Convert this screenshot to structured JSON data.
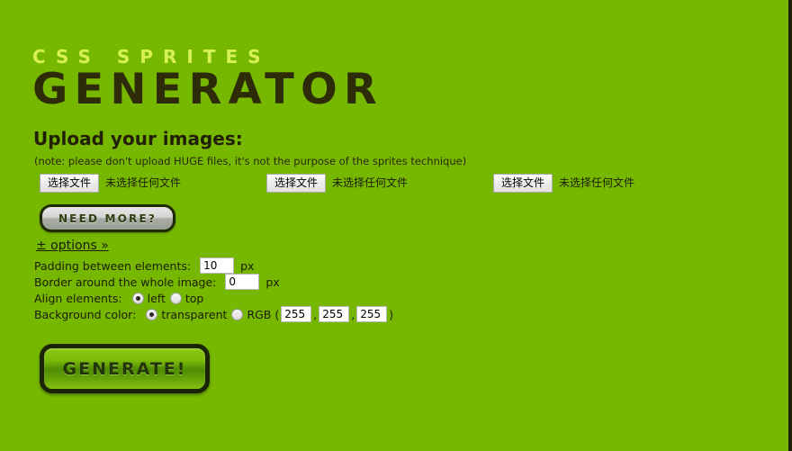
{
  "theme": {
    "background_color": "#76b800",
    "logo_small_color": "#d6f055",
    "logo_big_color": "#2e2b09",
    "text_color": "#1d1b06",
    "generate_button_color": "#7cbb0a",
    "need_more_button_color": "#d3d3d3",
    "edge_color": "#1d2206"
  },
  "logo": {
    "line1": "CSS SPRITES",
    "line2": "GENERATOR"
  },
  "upload": {
    "heading": "Upload your images:",
    "note": "(note: please don't upload HUGE files, it's not the purpose of the sprites technique)",
    "file_inputs": [
      {
        "button_label": "选择文件",
        "file_status": "未选择任何文件"
      },
      {
        "button_label": "选择文件",
        "file_status": "未选择任何文件"
      },
      {
        "button_label": "选择文件",
        "file_status": "未选择任何文件"
      }
    ],
    "need_more_label": "NEED MORE?"
  },
  "options": {
    "toggle_label": "± options »",
    "padding": {
      "label": "Padding between elements:",
      "value": "10",
      "unit": "px"
    },
    "border": {
      "label": "Border around the whole image:",
      "value": "0",
      "unit": "px"
    },
    "align": {
      "label": "Align elements:",
      "choices": [
        {
          "label": "left",
          "selected": true
        },
        {
          "label": "top",
          "selected": false
        }
      ]
    },
    "background": {
      "label": "Background color:",
      "choices": [
        {
          "label": "transparent",
          "selected": true
        },
        {
          "label": "RGB (",
          "selected": false
        }
      ],
      "rgb": {
        "r": "255",
        "g": "255",
        "b": "255"
      },
      "separator": ",",
      "close_paren": ")"
    }
  },
  "actions": {
    "generate_label": "GENERATE!"
  }
}
